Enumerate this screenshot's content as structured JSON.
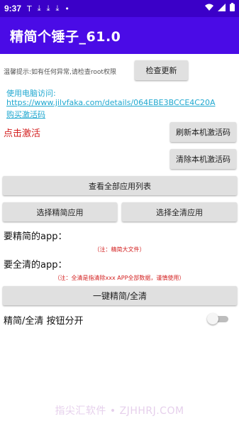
{
  "status_bar": {
    "time": "9:37",
    "icons": [
      "T-icon",
      "download-icon",
      "download-icon",
      "download-icon",
      "dot-icon"
    ],
    "right_icons": [
      "wifi-icon",
      "signal-icon",
      "battery-icon"
    ]
  },
  "app_bar": {
    "title": "精简个锤子_61.0"
  },
  "hint": "温馨提示:如有任何异常,请检查root权限",
  "check_update_label": "检查更新",
  "visit_label": "使用电脑访问:",
  "visit_url": "https://www.jilvfaka.com/details/064EBE3BCCE4C20A",
  "buy_label": "购买激活码",
  "click_activate": "点击激活",
  "refresh_code_label": "刷新本机激活码",
  "clear_code_label": "清除本机激活码",
  "view_all_apps_label": "查看全部应用列表",
  "select_slim_label": "选择精简应用",
  "select_clear_label": "选择全清应用",
  "slim_section_label": "要精简的app：",
  "slim_note": "（注：精简大文件）",
  "clear_section_label": "要全清的app：",
  "clear_note": "（注：全清是指清除xxx APP全部数据，谨慎使用）",
  "one_key_label": "一键精简/全清",
  "split_toggle_label": "精简/全清 按钮分开",
  "split_toggle_on": false,
  "watermark": "指尖汇软件 • ZJHHRJ.COM",
  "colors": {
    "status_bar": "#3B00C8",
    "app_bar": "#4A0BE6",
    "link": "#20a8d0",
    "warning": "#d32020",
    "button": "#e0e0e0"
  }
}
